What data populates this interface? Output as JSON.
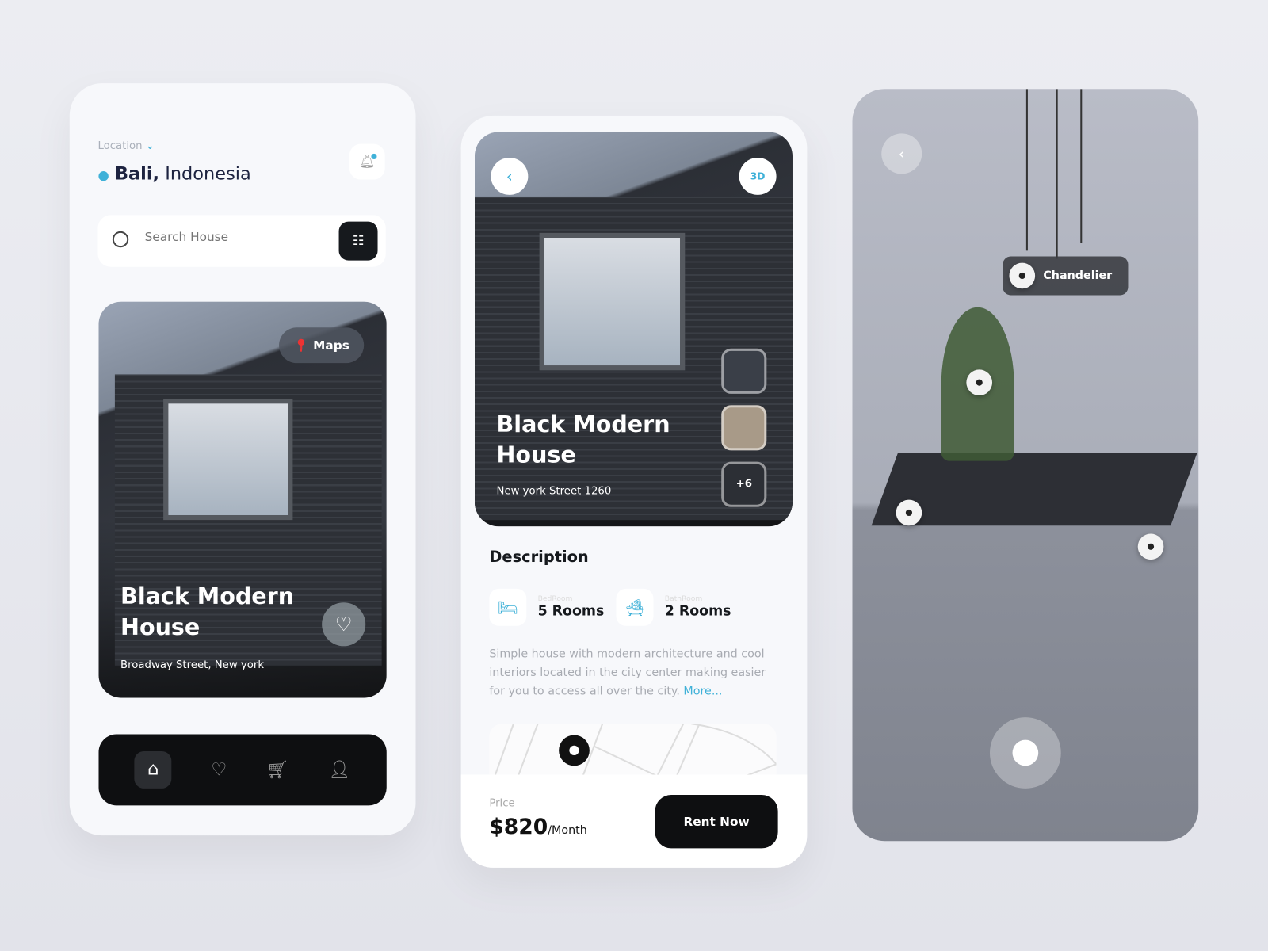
{
  "screen1": {
    "location_label": "Location",
    "city": "Bali,",
    "country": "Indonesia",
    "search_placeholder": "Search House",
    "card": {
      "maps_label": "Maps",
      "title_line1": "Black Modern",
      "title_line2": "House",
      "address": "Broadway Street, New york"
    },
    "nav": [
      "home-icon",
      "heart-icon",
      "cart-icon",
      "profile-icon"
    ]
  },
  "screen2": {
    "badge_3d": "3D",
    "title_line1": "Black Modern",
    "title_line2": "House",
    "address": "New york Street 1260",
    "more_photos": "+6",
    "description_title": "Description",
    "bedroom_label": "BedRoom",
    "bedroom_value": "5 Rooms",
    "bathroom_label": "BathRoom",
    "bathroom_value": "2 Rooms",
    "description": "Simple house with modern architecture and cool interiors located in the city center making easier for you to access all over the city.",
    "more_link": "More...",
    "price_label": "Price",
    "price": "$820",
    "price_unit": "/Month",
    "rent_button": "Rent Now"
  },
  "screen3": {
    "hotspot_label": "Chandelier"
  },
  "colors": {
    "accent": "#3fb1d8",
    "dark": "#111111"
  }
}
